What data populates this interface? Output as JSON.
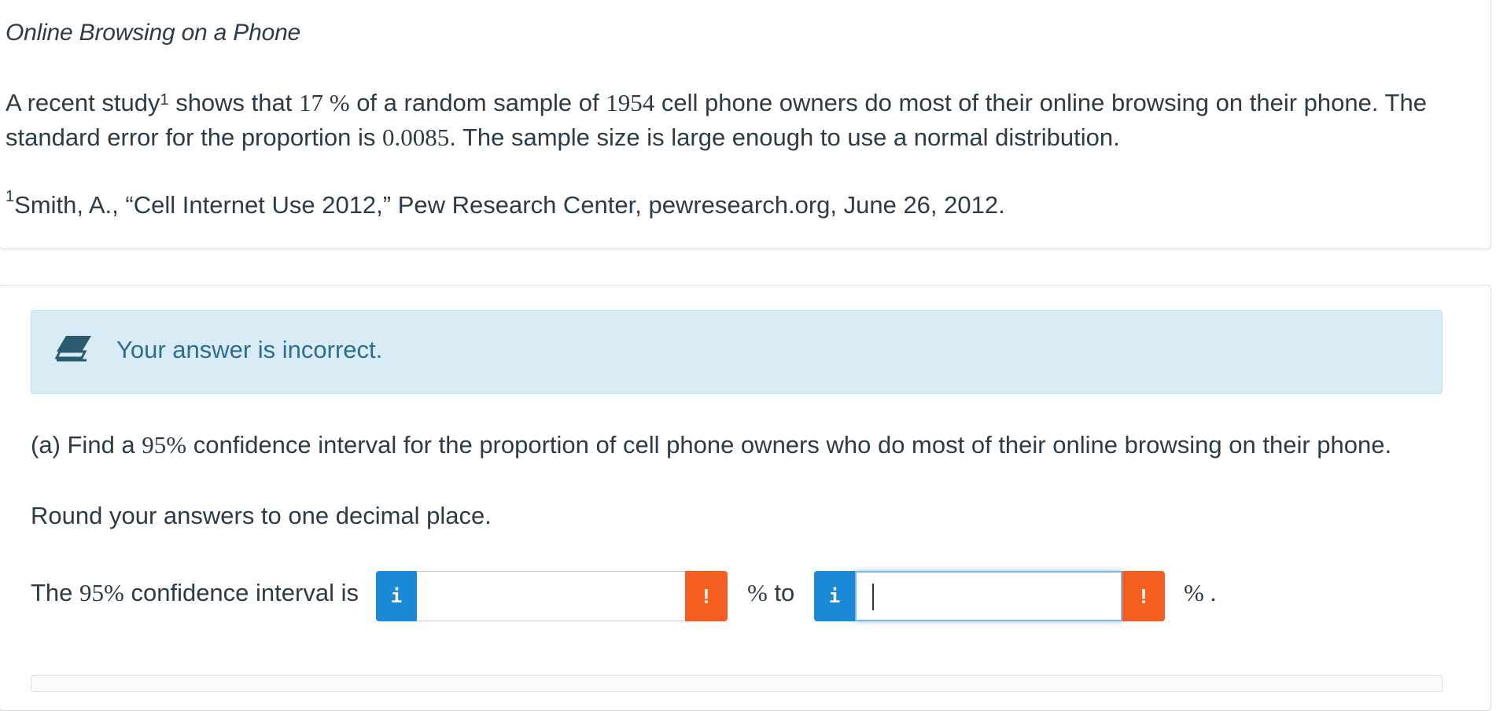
{
  "problem": {
    "title": "Online Browsing on a Phone",
    "intro_before_sup": "A recent study",
    "intro_sup": "1",
    "intro_after_sup": " shows that ",
    "percent_value": "17 %",
    "intro_mid": "  of a random sample of ",
    "sample_size": "1954",
    "intro_mid2": " cell phone owners do most of their online browsing on their phone. The standard error for the proportion is ",
    "standard_error": "0.0085",
    "intro_end": ". The sample size is large enough to use a normal distribution.",
    "footnote_sup": "1",
    "footnote_text": "Smith, A., “Cell Internet Use 2012,” Pew Research Center, pewresearch.org, June 26, 2012."
  },
  "feedback": {
    "icon": "eraser-icon",
    "message": "Your answer is incorrect."
  },
  "question": {
    "prompt_before": "(a) Find a ",
    "prompt_pct": "95%",
    "prompt_after": " confidence interval for the proportion of cell phone owners who do most of their online browsing on their phone.",
    "instruction": "Round your answers to one decimal place.",
    "interval_label_before": "The ",
    "interval_label_pct": "95%",
    "interval_label_after": " confidence interval is",
    "info_glyph": "i",
    "warn_glyph": "!",
    "lower_value": "",
    "upper_value": "",
    "mid_unit_pct": "%",
    "mid_unit_to": " to",
    "end_unit": "% ."
  },
  "colors": {
    "info": "#1a8ad8",
    "warning": "#f45f21",
    "alert_bg": "#d9ecf5",
    "alert_text": "#2b6e8f"
  }
}
